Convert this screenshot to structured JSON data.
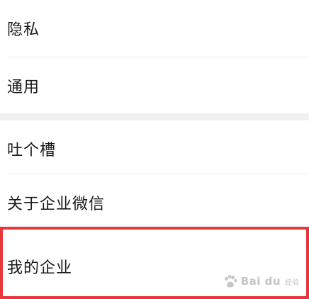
{
  "settings": {
    "items": [
      {
        "label": "隐私"
      },
      {
        "label": "通用"
      },
      {
        "label": "吐个槽"
      },
      {
        "label": "关于企业微信"
      },
      {
        "label": "我的企业"
      }
    ]
  },
  "highlight": {
    "color": "#e8373c",
    "target": "我的企业"
  },
  "watermark": {
    "text": "Bai du",
    "sub": "经验"
  }
}
